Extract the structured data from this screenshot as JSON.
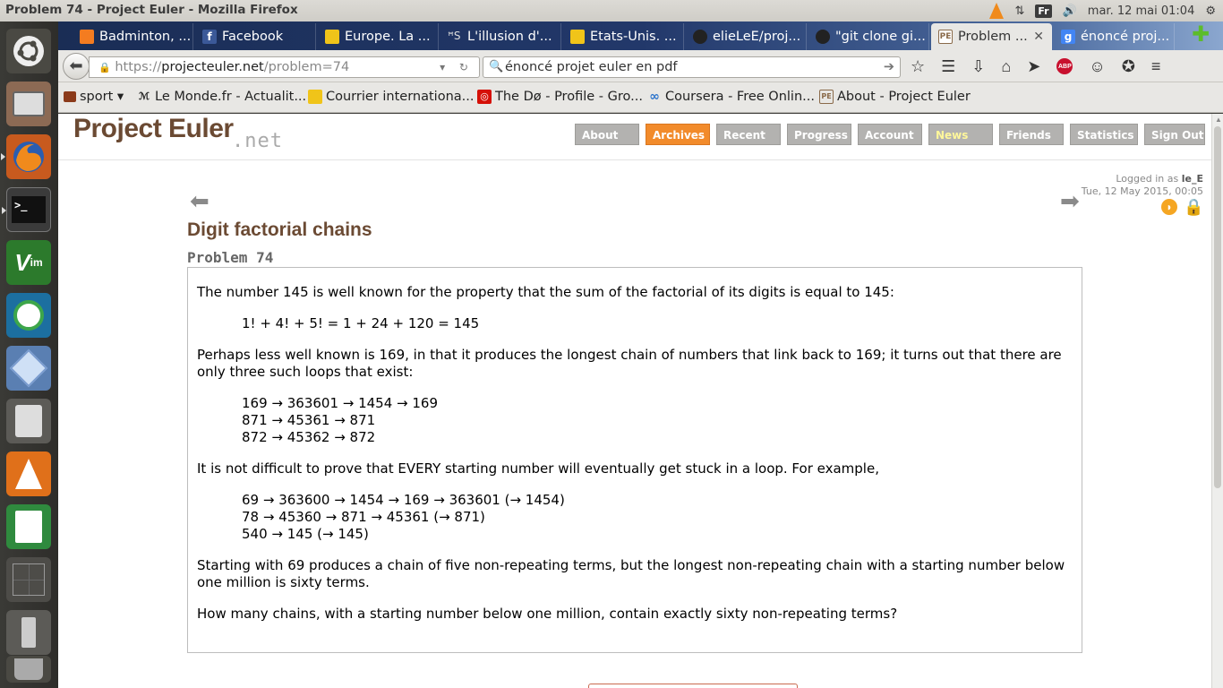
{
  "top_panel": {
    "window_title": "Problem 74 - Project Euler - Mozilla Firefox",
    "keyboard_layout": "Fr",
    "clock": "mar. 12 mai 01:04"
  },
  "tabs": [
    {
      "label": "Badminton, ...",
      "color": "#f47c20"
    },
    {
      "label": "Facebook",
      "color": "#3b5998"
    },
    {
      "label": "Europe. La ...",
      "color": "#f0c419"
    },
    {
      "label": "L'illusion d'...",
      "color": "#cccccc"
    },
    {
      "label": "Etats-Unis. ...",
      "color": "#f0c419"
    },
    {
      "label": "elieLeE/proj...",
      "color": "#222222"
    },
    {
      "label": "\"git clone gi...",
      "color": "#222222"
    },
    {
      "label": "Problem ...",
      "color": "#8a6a4a"
    },
    {
      "label": "énoncé proj...",
      "color": "#4285f4"
    }
  ],
  "navbar": {
    "url_scheme": "https://",
    "url_host": "projecteuler.net",
    "url_path": "/problem=74",
    "search_text": "énoncé projet euler en pdf"
  },
  "bookmarks": [
    {
      "label": "sport ▾",
      "icon": "folder-icon"
    },
    {
      "label": "Le Monde.fr - Actualit...",
      "icon": "lemonde-icon"
    },
    {
      "label": "Courrier internationa...",
      "icon": "courrier-icon"
    },
    {
      "label": "The Dø - Profile - Gro...",
      "icon": "lastfm-icon"
    },
    {
      "label": "Coursera - Free Onlin...",
      "icon": "coursera-icon"
    },
    {
      "label": "About - Project Euler",
      "icon": "pe-icon"
    }
  ],
  "site": {
    "logo": "Project Euler",
    "logo_suffix": ".net",
    "nav": [
      "About",
      "Archives",
      "Recent",
      "Progress",
      "Account",
      "News",
      "Friends",
      "Statistics",
      "Sign Out"
    ],
    "selected_nav": "Archives",
    "logged_in_prefix": "Logged in as",
    "username": "le_E",
    "datetime": "Tue, 12 May 2015, 00:05"
  },
  "problem": {
    "title": "Digit factorial chains",
    "number": "Problem 74",
    "p1": "The number 145 is well known for the property that the sum of the factorial of its digits is equal to 145:",
    "eq": "1! + 4! + 5! = 1 + 24 + 120 = 145",
    "p2": "Perhaps less well known is 169, in that it produces the longest chain of numbers that link back to 169; it turns out that there are only three such loops that exist:",
    "loops": [
      "169 → 363601 → 1454 → 169",
      "871 → 45361 → 871",
      "872 → 45362 → 872"
    ],
    "p3": "It is not difficult to prove that EVERY starting number will eventually get stuck in a loop. For example,",
    "examples": [
      "69 → 363600 → 1454 → 169 → 363601 (→ 1454)",
      "78 → 45360 → 871 → 45361 (→ 871)",
      "540 → 145 (→ 145)"
    ],
    "p4": "Starting with 69 produces a chain of five non-repeating terms, but the longest non-repeating chain with a starting number below one million is sixty terms.",
    "p5": "How many chains, with a starting number below one million, contain exactly sixty non-repeating terms?"
  }
}
